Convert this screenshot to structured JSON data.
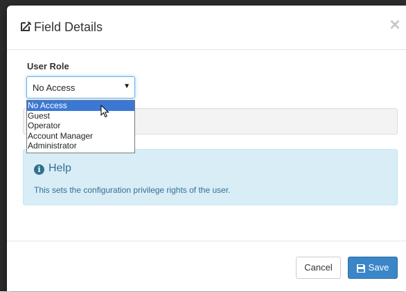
{
  "modal": {
    "title": "Field Details",
    "close_label": "×"
  },
  "form": {
    "label": "User Role",
    "selected_value": "No Access",
    "options": [
      "No Access",
      "Guest",
      "Operator",
      "Account Manager",
      "Administrator"
    ]
  },
  "help": {
    "title": "Help",
    "text": "This sets the configuration privilege rights of the user."
  },
  "footer": {
    "cancel_label": "Cancel",
    "save_label": "Save"
  },
  "colors": {
    "primary": "#3a86c8",
    "highlight": "#3b78d5",
    "help_bg": "#d9edf7",
    "help_text": "#31708f"
  },
  "icons": [
    "edit-icon",
    "close-icon",
    "caret-down-icon",
    "info-icon",
    "save-icon",
    "mouse-pointer-icon"
  ]
}
